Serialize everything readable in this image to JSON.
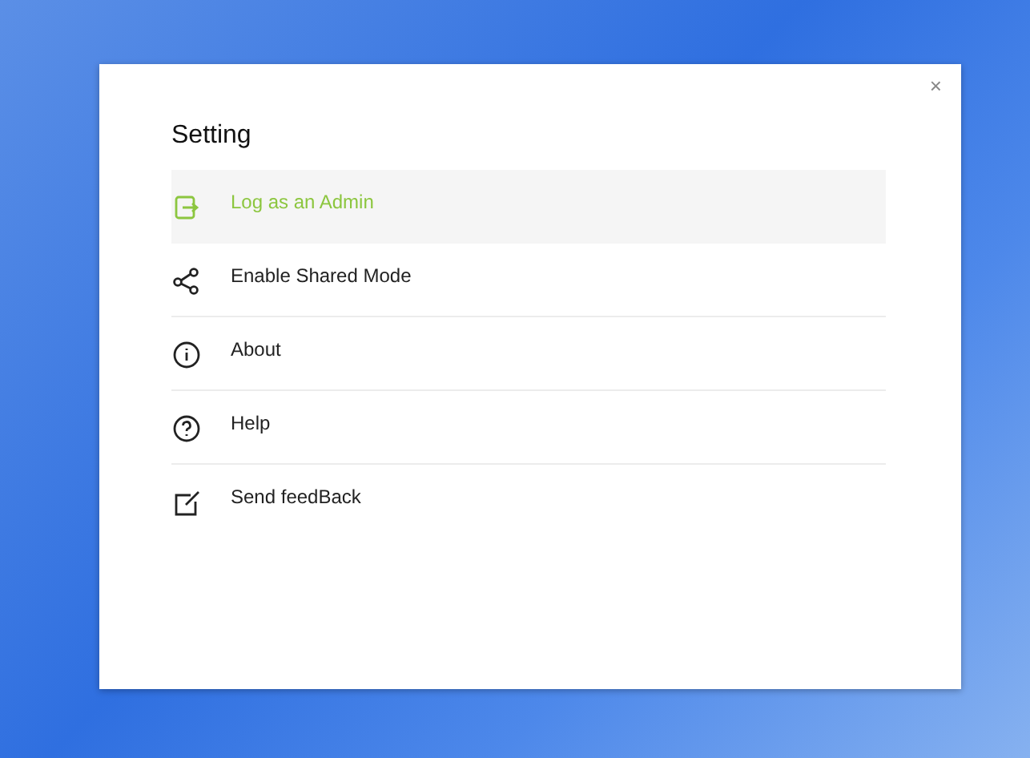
{
  "dialog": {
    "close": "×",
    "title": "Setting",
    "items": [
      {
        "kind": "login",
        "label": "Log as an Admin",
        "selected": true
      },
      {
        "kind": "share",
        "label": "Enable Shared Mode",
        "selected": false
      },
      {
        "kind": "info",
        "label": "About",
        "selected": false
      },
      {
        "kind": "help",
        "label": "Help",
        "selected": false
      },
      {
        "kind": "feedback",
        "label": "Send feedBack",
        "selected": false
      }
    ]
  }
}
